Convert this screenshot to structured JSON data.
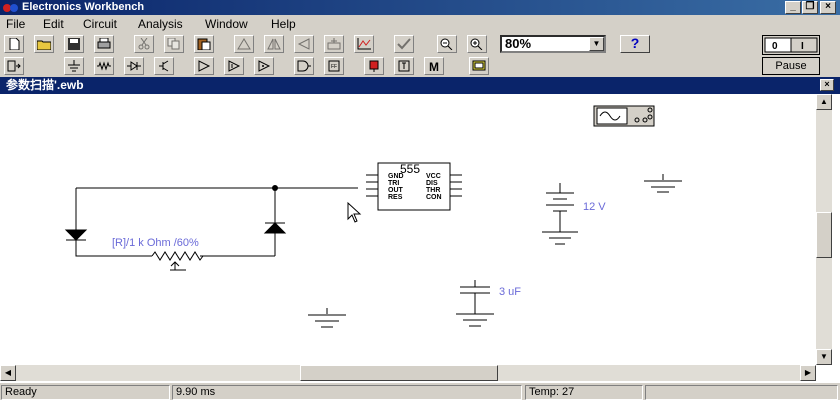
{
  "window": {
    "title": "Electronics Workbench"
  },
  "menu": [
    "File",
    "Edit",
    "Circuit",
    "Analysis",
    "Window",
    "Help"
  ],
  "toolbar": {
    "zoom_value": "80%",
    "help_label": "?",
    "pause_label": "Pause"
  },
  "document": {
    "title": "参数扫描'.ewb"
  },
  "circuit": {
    "potentiometer_label": "[R]/1 k Ohm /60%",
    "chip_label": "555",
    "chip_pins_left": [
      "GND",
      "TRI",
      "OUT",
      "RES"
    ],
    "chip_pins_right": [
      "VCC",
      "DIS",
      "THR",
      "CON"
    ],
    "battery_label": "12 V",
    "capacitor_label": "3 uF"
  },
  "status": {
    "state": "Ready",
    "time": "9.90 ms",
    "temp": "Temp:  27"
  },
  "colors": {
    "title_bar": "#0a246a",
    "component_label": "#6a6ad8"
  }
}
